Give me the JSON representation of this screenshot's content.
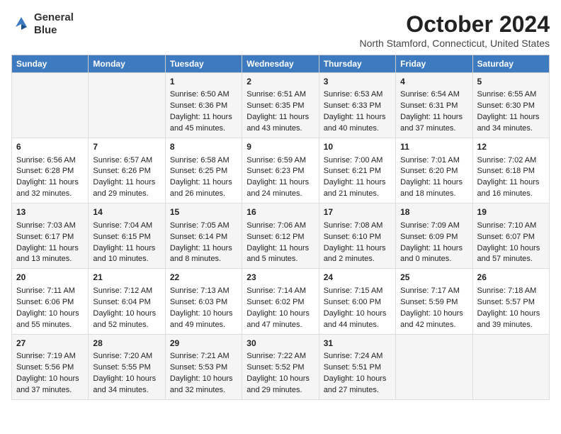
{
  "header": {
    "logo_line1": "General",
    "logo_line2": "Blue",
    "month": "October 2024",
    "location": "North Stamford, Connecticut, United States"
  },
  "days_of_week": [
    "Sunday",
    "Monday",
    "Tuesday",
    "Wednesday",
    "Thursday",
    "Friday",
    "Saturday"
  ],
  "weeks": [
    [
      {
        "num": "",
        "data": ""
      },
      {
        "num": "",
        "data": ""
      },
      {
        "num": "1",
        "data": "Sunrise: 6:50 AM\nSunset: 6:36 PM\nDaylight: 11 hours and 45 minutes."
      },
      {
        "num": "2",
        "data": "Sunrise: 6:51 AM\nSunset: 6:35 PM\nDaylight: 11 hours and 43 minutes."
      },
      {
        "num": "3",
        "data": "Sunrise: 6:53 AM\nSunset: 6:33 PM\nDaylight: 11 hours and 40 minutes."
      },
      {
        "num": "4",
        "data": "Sunrise: 6:54 AM\nSunset: 6:31 PM\nDaylight: 11 hours and 37 minutes."
      },
      {
        "num": "5",
        "data": "Sunrise: 6:55 AM\nSunset: 6:30 PM\nDaylight: 11 hours and 34 minutes."
      }
    ],
    [
      {
        "num": "6",
        "data": "Sunrise: 6:56 AM\nSunset: 6:28 PM\nDaylight: 11 hours and 32 minutes."
      },
      {
        "num": "7",
        "data": "Sunrise: 6:57 AM\nSunset: 6:26 PM\nDaylight: 11 hours and 29 minutes."
      },
      {
        "num": "8",
        "data": "Sunrise: 6:58 AM\nSunset: 6:25 PM\nDaylight: 11 hours and 26 minutes."
      },
      {
        "num": "9",
        "data": "Sunrise: 6:59 AM\nSunset: 6:23 PM\nDaylight: 11 hours and 24 minutes."
      },
      {
        "num": "10",
        "data": "Sunrise: 7:00 AM\nSunset: 6:21 PM\nDaylight: 11 hours and 21 minutes."
      },
      {
        "num": "11",
        "data": "Sunrise: 7:01 AM\nSunset: 6:20 PM\nDaylight: 11 hours and 18 minutes."
      },
      {
        "num": "12",
        "data": "Sunrise: 7:02 AM\nSunset: 6:18 PM\nDaylight: 11 hours and 16 minutes."
      }
    ],
    [
      {
        "num": "13",
        "data": "Sunrise: 7:03 AM\nSunset: 6:17 PM\nDaylight: 11 hours and 13 minutes."
      },
      {
        "num": "14",
        "data": "Sunrise: 7:04 AM\nSunset: 6:15 PM\nDaylight: 11 hours and 10 minutes."
      },
      {
        "num": "15",
        "data": "Sunrise: 7:05 AM\nSunset: 6:14 PM\nDaylight: 11 hours and 8 minutes."
      },
      {
        "num": "16",
        "data": "Sunrise: 7:06 AM\nSunset: 6:12 PM\nDaylight: 11 hours and 5 minutes."
      },
      {
        "num": "17",
        "data": "Sunrise: 7:08 AM\nSunset: 6:10 PM\nDaylight: 11 hours and 2 minutes."
      },
      {
        "num": "18",
        "data": "Sunrise: 7:09 AM\nSunset: 6:09 PM\nDaylight: 11 hours and 0 minutes."
      },
      {
        "num": "19",
        "data": "Sunrise: 7:10 AM\nSunset: 6:07 PM\nDaylight: 10 hours and 57 minutes."
      }
    ],
    [
      {
        "num": "20",
        "data": "Sunrise: 7:11 AM\nSunset: 6:06 PM\nDaylight: 10 hours and 55 minutes."
      },
      {
        "num": "21",
        "data": "Sunrise: 7:12 AM\nSunset: 6:04 PM\nDaylight: 10 hours and 52 minutes."
      },
      {
        "num": "22",
        "data": "Sunrise: 7:13 AM\nSunset: 6:03 PM\nDaylight: 10 hours and 49 minutes."
      },
      {
        "num": "23",
        "data": "Sunrise: 7:14 AM\nSunset: 6:02 PM\nDaylight: 10 hours and 47 minutes."
      },
      {
        "num": "24",
        "data": "Sunrise: 7:15 AM\nSunset: 6:00 PM\nDaylight: 10 hours and 44 minutes."
      },
      {
        "num": "25",
        "data": "Sunrise: 7:17 AM\nSunset: 5:59 PM\nDaylight: 10 hours and 42 minutes."
      },
      {
        "num": "26",
        "data": "Sunrise: 7:18 AM\nSunset: 5:57 PM\nDaylight: 10 hours and 39 minutes."
      }
    ],
    [
      {
        "num": "27",
        "data": "Sunrise: 7:19 AM\nSunset: 5:56 PM\nDaylight: 10 hours and 37 minutes."
      },
      {
        "num": "28",
        "data": "Sunrise: 7:20 AM\nSunset: 5:55 PM\nDaylight: 10 hours and 34 minutes."
      },
      {
        "num": "29",
        "data": "Sunrise: 7:21 AM\nSunset: 5:53 PM\nDaylight: 10 hours and 32 minutes."
      },
      {
        "num": "30",
        "data": "Sunrise: 7:22 AM\nSunset: 5:52 PM\nDaylight: 10 hours and 29 minutes."
      },
      {
        "num": "31",
        "data": "Sunrise: 7:24 AM\nSunset: 5:51 PM\nDaylight: 10 hours and 27 minutes."
      },
      {
        "num": "",
        "data": ""
      },
      {
        "num": "",
        "data": ""
      }
    ]
  ]
}
